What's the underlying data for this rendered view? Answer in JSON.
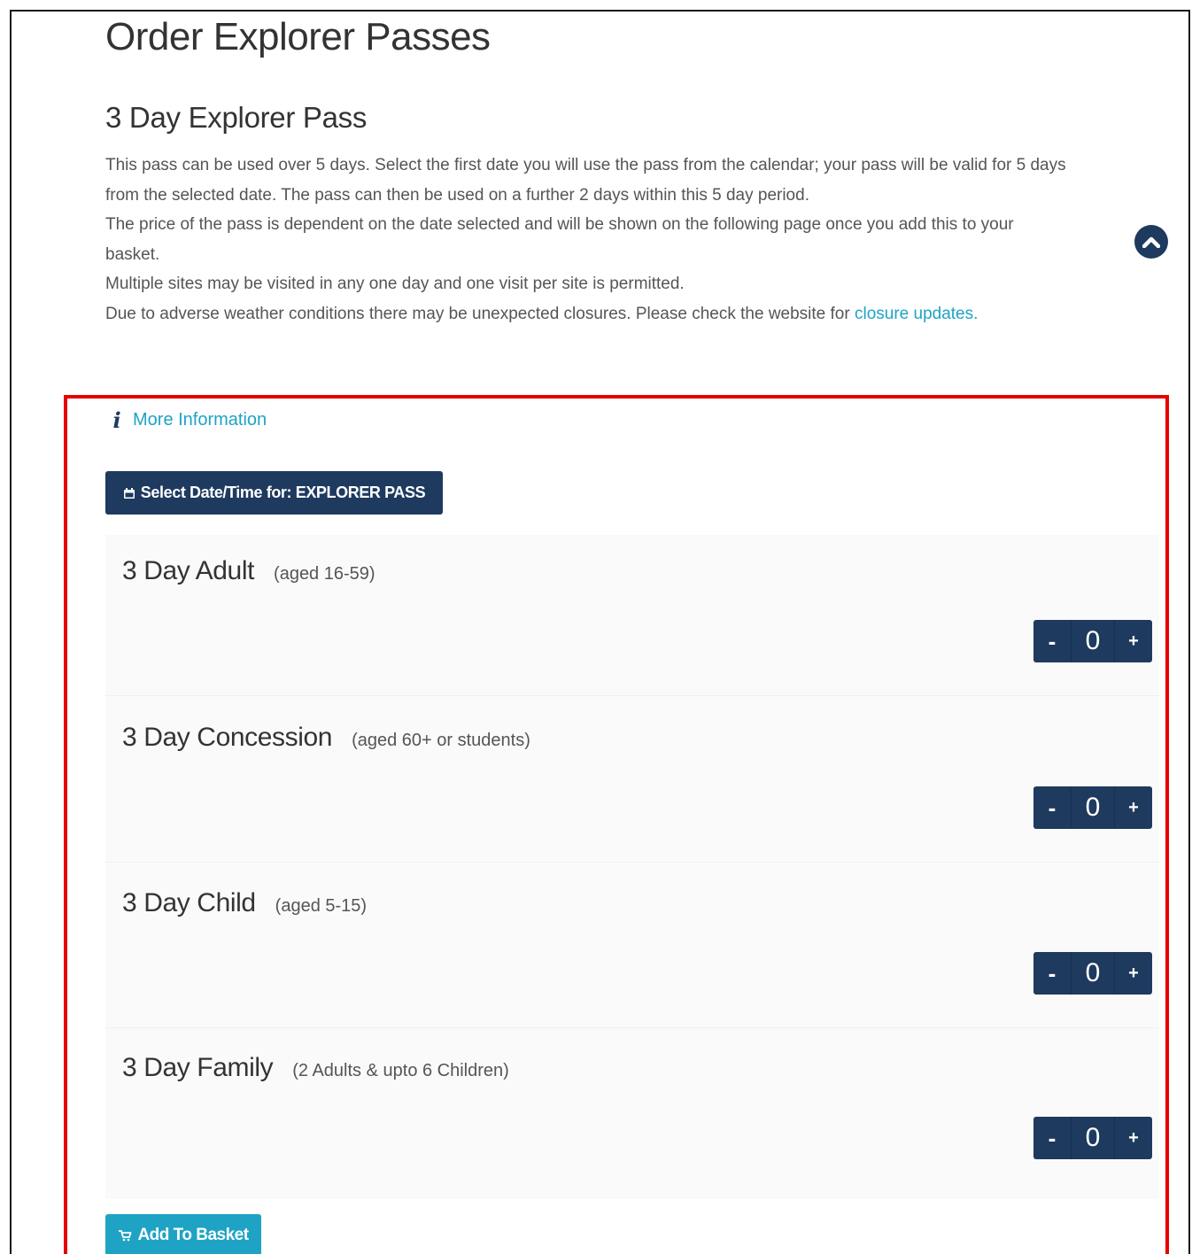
{
  "page": {
    "title": "Order Explorer Passes"
  },
  "section": {
    "title": "3 Day Explorer Pass",
    "paragraphs": [
      "This pass can be used over 5 days. Select the first date you will use the pass from the calendar; your pass will be valid for 5 days from the selected date. The pass can then be used on a further 2 days within this 5 day period.",
      "The price of the pass is dependent on the date selected and will be shown on the following page once you add this to your basket.",
      "Multiple sites may be visited in any one day and one visit per site is permitted."
    ],
    "closure_text": "Due to adverse weather conditions there may be unexpected closures. Please check the website for ",
    "closure_link": "closure updates."
  },
  "more_info": {
    "label": "More Information",
    "icon": "info-icon"
  },
  "select_date": {
    "label": "Select Date/Time for: EXPLORER PASS",
    "icon": "calendar-icon"
  },
  "tickets": [
    {
      "title": "3 Day Adult",
      "subtitle": "(aged 16-59)",
      "quantity": "0",
      "minus": "-",
      "plus": "+"
    },
    {
      "title": "3 Day Concession",
      "subtitle": "(aged 60+ or students)",
      "quantity": "0",
      "minus": "-",
      "plus": "+"
    },
    {
      "title": "3 Day Child",
      "subtitle": "(aged 5-15)",
      "quantity": "0",
      "minus": "-",
      "plus": "+"
    },
    {
      "title": "3 Day Family",
      "subtitle": "(2 Adults & upto 6 Children)",
      "quantity": "0",
      "minus": "-",
      "plus": "+"
    }
  ],
  "add_to_basket": {
    "label": "Add To Basket",
    "icon": "cart-icon"
  },
  "colors": {
    "navy": "#1e3a5f",
    "link": "#1fa3c4",
    "highlight": "#e60000"
  }
}
